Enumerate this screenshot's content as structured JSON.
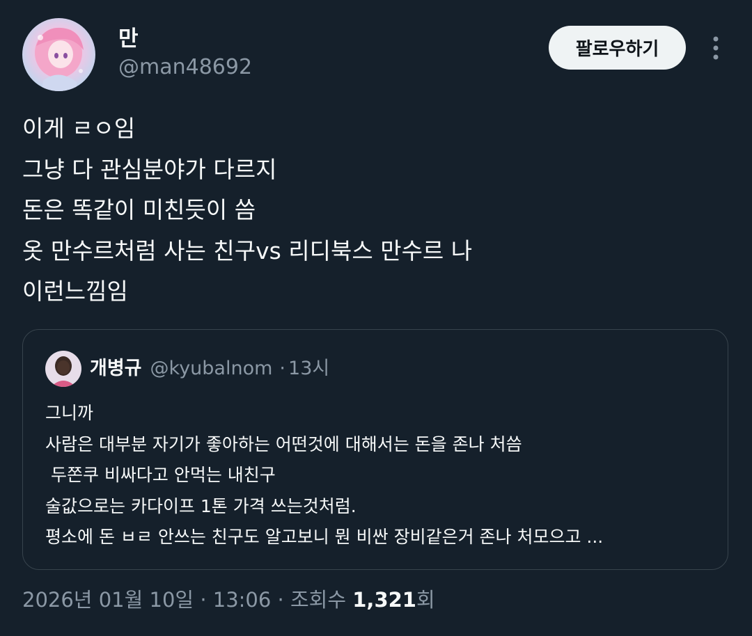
{
  "author": {
    "display_name": "만",
    "handle": "@man48692",
    "avatar_icon": "anime-avatar-icon"
  },
  "actions": {
    "follow_label": "팔로우하기",
    "more_icon": "more-vertical-icon"
  },
  "tweet": {
    "lines": [
      "이게 ㄹㅇ임",
      "그냥 다 관심분야가 다르지",
      "돈은 똑같이 미친듯이 씀",
      "옷 만수르처럼 사는 친구vs 리디북스 만수르 나",
      "이런느낌임"
    ]
  },
  "quote": {
    "display_name": "개병규",
    "handle": "@kyubalnom",
    "separator": "·",
    "time": "13시",
    "avatar_icon": "person-avatar-icon",
    "lines": [
      "그니까",
      "사람은 대부분 자기가 좋아하는 어떤것에 대해서는 돈을 존나 처씀",
      " 두쫀쿠 비싸다고 안먹는 내친구",
      "술값으로는 카다이프 1톤 가격 쓰는것처럼.",
      "평소에 돈 ㅂㄹ 안쓰는 친구도 알고보니 뭔 비싼 장비같은거 존나 처모으고 ..."
    ]
  },
  "meta": {
    "date": "2026년 01월 10일",
    "separator": "·",
    "time": "13:06",
    "views_label": "조회수",
    "views_count": "1,321",
    "views_suffix": "회"
  },
  "colors": {
    "background": "#15202b",
    "text_primary": "#f7f9f9",
    "text_secondary": "#8b98a5",
    "border": "#38444d",
    "follow_button_bg": "#eff3f4"
  }
}
